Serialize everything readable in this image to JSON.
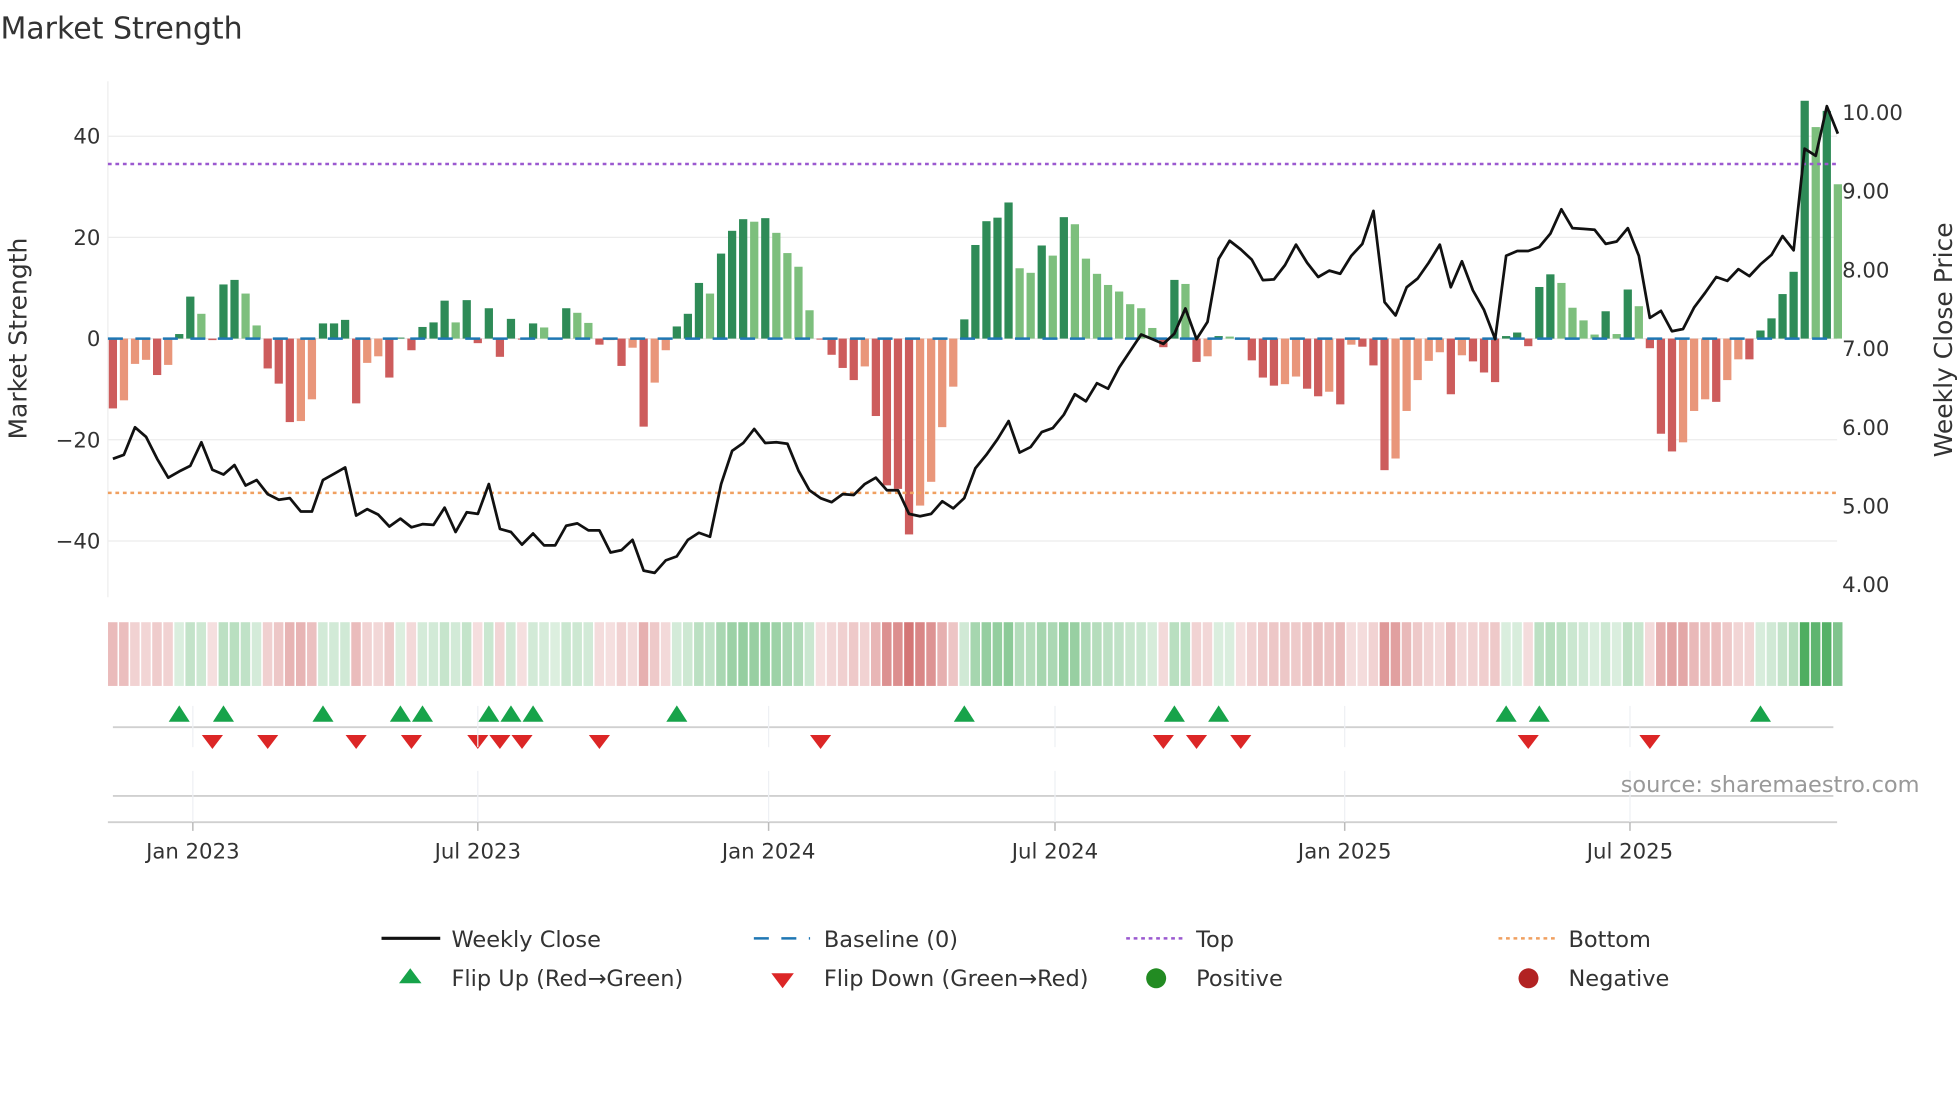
{
  "chart_data": {
    "type": "bar+line",
    "title": "Market Strength",
    "ylabel": "Market Strength",
    "y2label": "Weekly Close Price",
    "ylim": [
      -51,
      51
    ],
    "y2lim": [
      3.8,
      10.4
    ],
    "yticks": [
      {
        "v": 40,
        "label": "40"
      },
      {
        "v": 20,
        "label": "20"
      },
      {
        "v": 0,
        "label": "0"
      },
      {
        "v": -20,
        "label": "−20"
      },
      {
        "v": -40,
        "label": "−40"
      }
    ],
    "y2ticks": [
      {
        "v": 10,
        "label": "10.00"
      },
      {
        "v": 9,
        "label": "9.00"
      },
      {
        "v": 8,
        "label": "8.00"
      },
      {
        "v": 7,
        "label": "7.00"
      },
      {
        "v": 6,
        "label": "6.00"
      },
      {
        "v": 5,
        "label": "5.00"
      },
      {
        "v": 4,
        "label": "4.00"
      }
    ],
    "xticks": [
      "Jan 2023",
      "Jul 2023",
      "Jan 2024",
      "Jul 2024",
      "Jan 2025",
      "Jul 2025"
    ],
    "top_level": 34.5,
    "bottom_level": -30.5,
    "baseline": 0,
    "strength": [
      -13.8,
      -12.2,
      -5,
      -4.2,
      -7.2,
      -5.2,
      0.9,
      8.3,
      4.9,
      -0.3,
      10.7,
      11.6,
      8.9,
      2.6,
      -5.9,
      -8.9,
      -16.5,
      -16.3,
      -12,
      3,
      3,
      3.7,
      -12.8,
      -4.8,
      -3.5,
      -7.7,
      0.2,
      -2.3,
      2.3,
      3.2,
      7.5,
      3.2,
      7.6,
      -0.9,
      6,
      -3.6,
      3.9,
      -0.2,
      3,
      2.2,
      0.2,
      6,
      5.1,
      3.1,
      -1.2,
      -0.3,
      -5.4,
      -1.8,
      -17.4,
      -8.7,
      -2.3,
      2.4,
      4.9,
      11,
      8.9,
      16.8,
      21.3,
      23.6,
      23.1,
      23.8,
      20.9,
      16.9,
      14.2,
      5.6,
      -0.2,
      -3.2,
      -5.8,
      -8.2,
      -5.5,
      -15.3,
      -29,
      -29.7,
      -38.7,
      -33,
      -28.3,
      -17.5,
      -9.5,
      3.8,
      18.5,
      23.2,
      23.9,
      26.9,
      13.9,
      13,
      18.4,
      16.4,
      24,
      22.6,
      15.8,
      12.8,
      10.6,
      9.3,
      6.8,
      6,
      2.1,
      -1.7,
      11.6,
      10.8,
      -4.6,
      -3.5,
      0.5,
      0.4,
      -0.2,
      -4.3,
      -7.7,
      -9.3,
      -9,
      -7.5,
      -9.9,
      -11.4,
      -10.5,
      -13,
      -1.2,
      -1.6,
      -5.3,
      -26,
      -23.7,
      -14.3,
      -8.2,
      -4.4,
      -2.7,
      -11,
      -3.3,
      -4.5,
      -6.7,
      -8.6,
      0.5,
      1.2,
      -1.5,
      10.2,
      12.7,
      11,
      6.1,
      3.6,
      0.8,
      5.4,
      0.9,
      9.7,
      6.4,
      -1.9,
      -18.8,
      -22.3,
      -20.5,
      -14.3,
      -12,
      -12.5,
      -8.2,
      -4.1,
      -4.1,
      1.6,
      4,
      8.8,
      13.2,
      47,
      41.8,
      45,
      30.5
    ],
    "weekly_close": [
      5.6,
      5.65,
      6.0,
      5.88,
      5.6,
      5.36,
      5.44,
      5.51,
      5.81,
      5.46,
      5.4,
      5.52,
      5.26,
      5.33,
      5.15,
      5.08,
      5.1,
      4.93,
      4.93,
      5.33,
      5.41,
      5.49,
      4.88,
      4.96,
      4.89,
      4.74,
      4.84,
      4.73,
      4.77,
      4.76,
      4.98,
      4.67,
      4.92,
      4.9,
      5.28,
      4.71,
      4.67,
      4.51,
      4.65,
      4.5,
      4.5,
      4.75,
      4.78,
      4.69,
      4.69,
      4.41,
      4.44,
      4.57,
      4.18,
      4.15,
      4.31,
      4.36,
      4.57,
      4.66,
      4.61,
      5.28,
      5.7,
      5.8,
      5.98,
      5.8,
      5.81,
      5.79,
      5.45,
      5.2,
      5.1,
      5.05,
      5.15,
      5.14,
      5.28,
      5.36,
      5.2,
      5.2,
      4.9,
      4.87,
      4.9,
      5.06,
      4.97,
      5.1,
      5.48,
      5.65,
      5.85,
      6.08,
      5.68,
      5.75,
      5.94,
      5.99,
      6.16,
      6.42,
      6.33,
      6.56,
      6.49,
      6.76,
      6.97,
      7.18,
      7.12,
      7.06,
      7.19,
      7.51,
      7.12,
      7.34,
      8.14,
      8.37,
      8.26,
      8.13,
      7.87,
      7.88,
      8.06,
      8.32,
      8.09,
      7.91,
      7.99,
      7.95,
      8.18,
      8.33,
      8.75,
      7.59,
      7.42,
      7.78,
      7.89,
      8.09,
      8.32,
      7.78,
      8.11,
      7.74,
      7.49,
      7.12,
      8.18,
      8.24,
      8.24,
      8.29,
      8.46,
      8.77,
      8.53,
      8.52,
      8.51,
      8.33,
      8.36,
      8.53,
      8.18,
      7.39,
      7.48,
      7.22,
      7.25,
      7.52,
      7.71,
      7.91,
      7.86,
      8.01,
      7.92,
      8.07,
      8.19,
      8.43,
      8.25,
      9.54,
      9.45,
      10.08,
      9.73
    ],
    "legend": {
      "placement": "bottom",
      "items": [
        "Weekly Close",
        "Baseline (0)",
        "Top",
        "Bottom",
        "Flip Up (Red→Green)",
        "Flip Down (Green→Red)",
        "Positive",
        "Negative"
      ]
    },
    "grid": true
  },
  "colors": {
    "rising_positive": "#2e8b57",
    "falling_positive": "#7dbf7d",
    "falling_negative": "#cd5c5c",
    "rising_negative": "#e9967a",
    "baseline": "#1f77b4",
    "top": "#9b59d0",
    "bottom": "#f0a060",
    "line": "#111111",
    "flip_up": "#17a34a",
    "flip_down": "#dc2626",
    "positive": "#228b22",
    "negative": "#b22222"
  },
  "source": "source: sharemaestro.com"
}
